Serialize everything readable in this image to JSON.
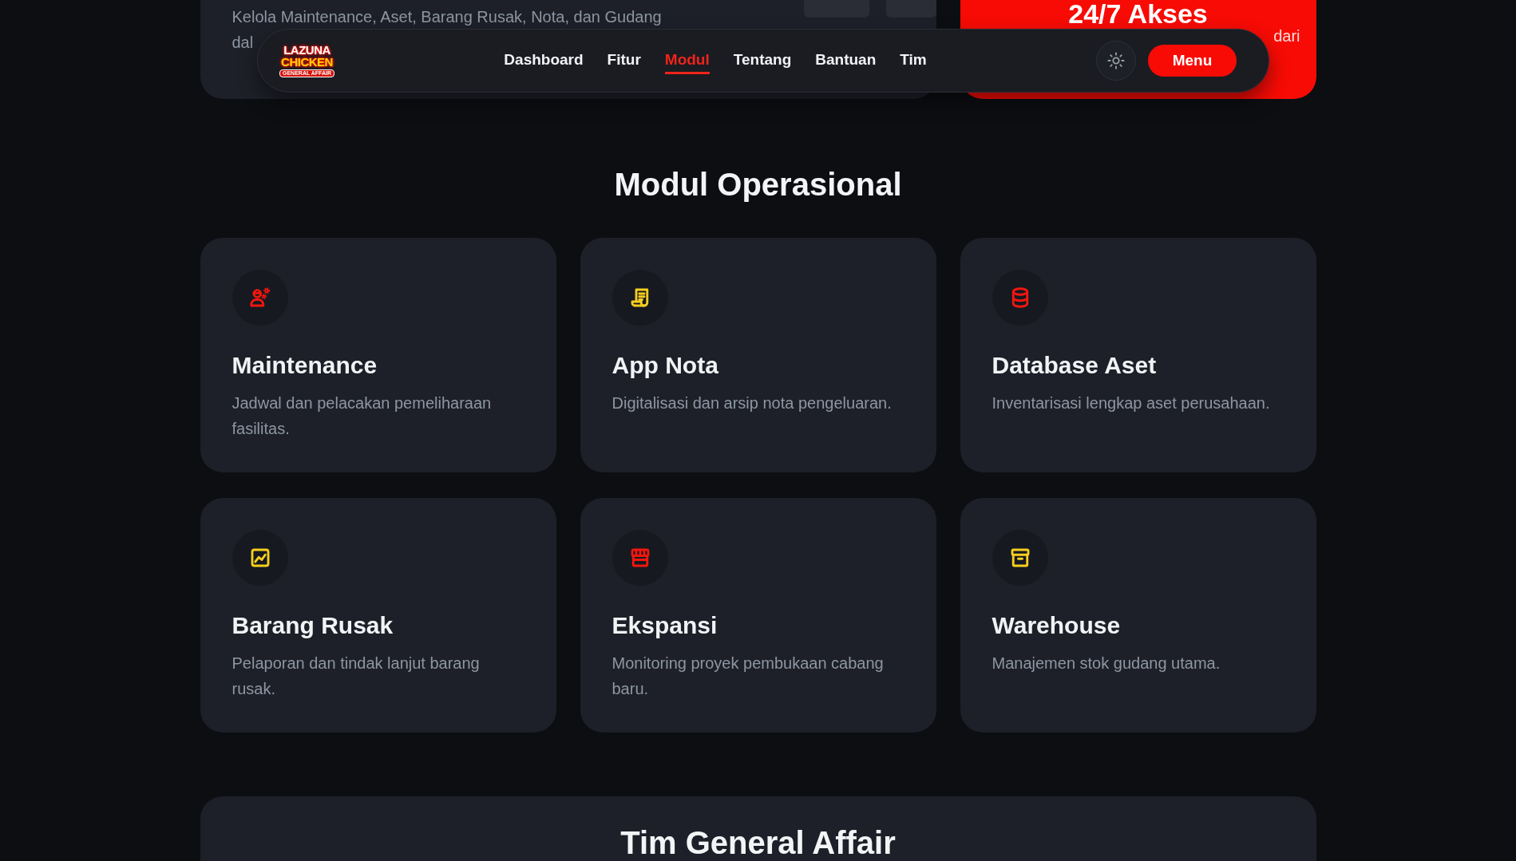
{
  "hero": {
    "description_lines": [
      "Kelola Maintenance, Aset, Barang Rusak, Nota, dan Gudang",
      "dal"
    ],
    "highlight": {
      "title": "24/7 Akses",
      "subtitle": "dari"
    }
  },
  "nav": {
    "logo": {
      "line_1": "LAZUNA",
      "line_2": "CHICKEN",
      "tagline": "GENERAL AFFAIR"
    },
    "links": [
      {
        "label": "Dashboard",
        "selected": false
      },
      {
        "label": "Fitur",
        "selected": false
      },
      {
        "label": "Modul",
        "selected": true
      },
      {
        "label": "Tentang",
        "selected": false
      },
      {
        "label": "Bantuan",
        "selected": false
      },
      {
        "label": "Tim",
        "selected": false
      }
    ],
    "menu_button": "Menu"
  },
  "modules": {
    "title": "Modul Operasional",
    "items": [
      {
        "title": "Maintenance",
        "description": "Jadwal dan pelacakan pemeliharaan fasilitas.",
        "color": "#f1170f"
      },
      {
        "title": "App Nota",
        "description": "Digitalisasi dan arsip nota pengeluaran.",
        "color": "#f6cf1e"
      },
      {
        "title": "Database Aset",
        "description": "Inventarisasi lengkap aset perusahaan.",
        "color": "#f1170f"
      },
      {
        "title": "Barang Rusak",
        "description": "Pelaporan dan tindak lanjut barang rusak.",
        "color": "#f6cf1e"
      },
      {
        "title": "Ekspansi",
        "description": "Monitoring proyek pembukaan cabang baru.",
        "color": "#f1170f"
      },
      {
        "title": "Warehouse",
        "description": "Manajemen stok gudang utama.",
        "color": "#f6cf1e"
      }
    ]
  },
  "team": {
    "title": "Tim General Affair"
  }
}
